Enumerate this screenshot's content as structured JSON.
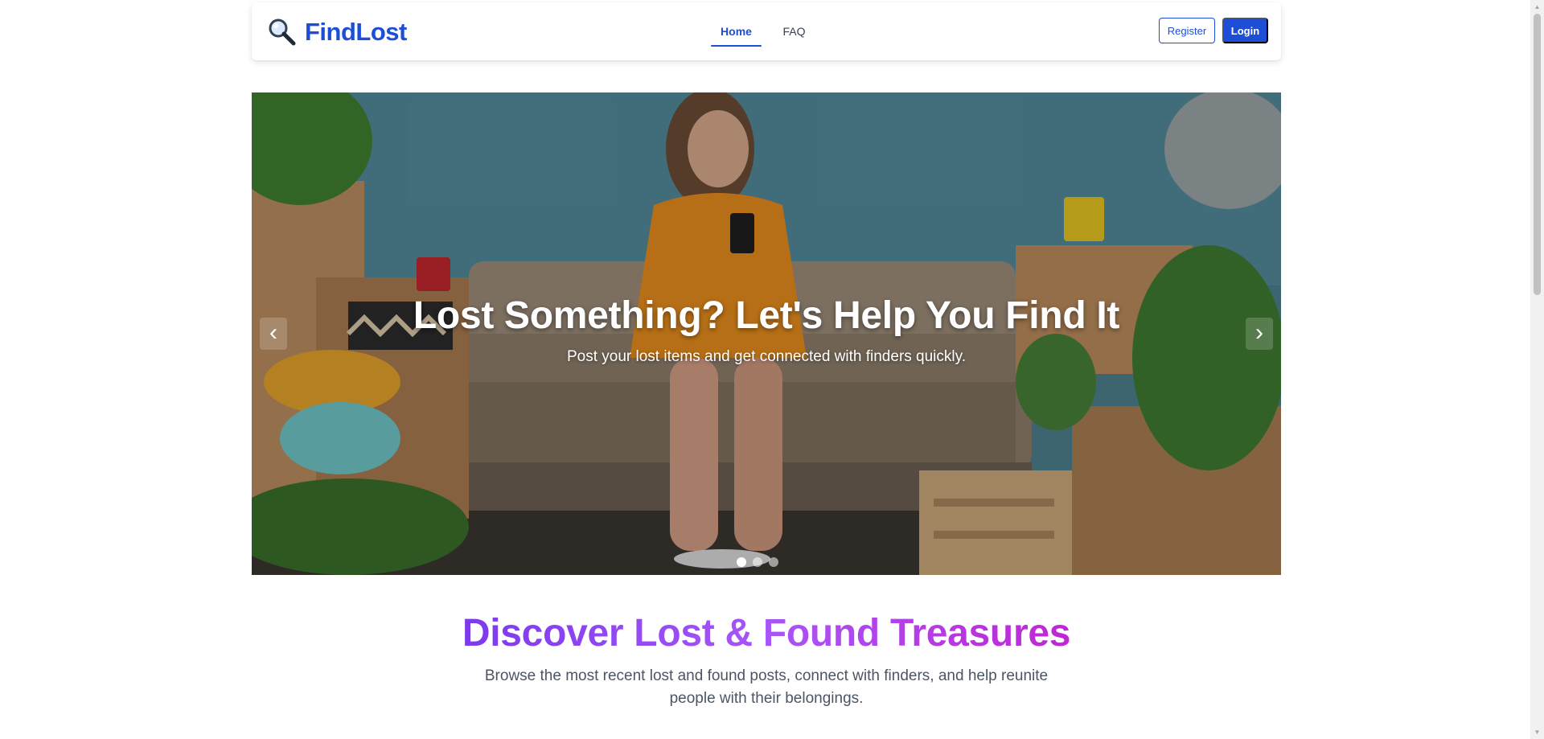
{
  "header": {
    "brand_name": "FindLost",
    "brand_icon": "magnifying-glass-icon",
    "nav": {
      "home": "Home",
      "faq": "FAQ"
    },
    "buttons": {
      "register": "Register",
      "login": "Login"
    },
    "accent_color": "#1d4ed8"
  },
  "hero": {
    "title": "Lost Something? Let's Help You Find It",
    "subtitle": "Post your lost items and get connected with finders quickly.",
    "prev_label": "‹",
    "next_label": "›",
    "active_slide": 1,
    "slide_count": 3
  },
  "discover": {
    "title": "Discover Lost & Found Treasures",
    "description": "Browse the most recent lost and found posts, connect with finders, and help reunite people with their belongings.",
    "gradient_colors": [
      "#7c3aed",
      "#a855f7",
      "#c026d3"
    ]
  }
}
